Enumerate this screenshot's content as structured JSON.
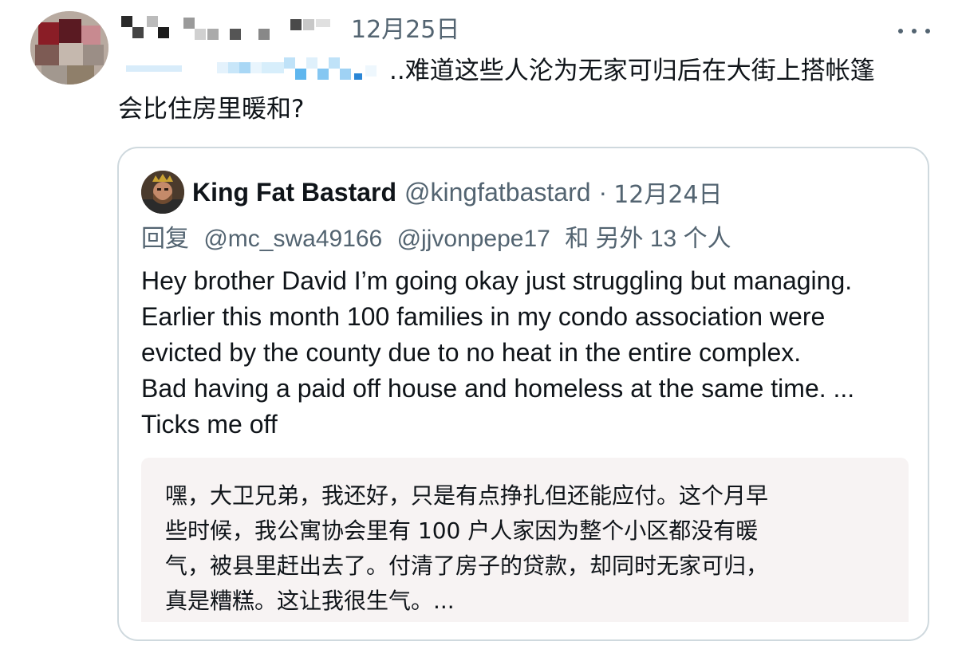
{
  "post": {
    "date": "12月25日",
    "text_line1": "..难道这些人沦为无家可归后在大街上搭帐篷",
    "text_line2": "会比住房里暖和?"
  },
  "quoted": {
    "display_name": "King Fat Bastard",
    "handle": "@kingfatbastard",
    "separator": "·",
    "date": "12月24日",
    "reply_prefix": "回复",
    "reply_handle_1": "@mc_swa49166",
    "reply_handle_2": "@jjvonpepe17",
    "reply_suffix": "和 另外 13 个人",
    "body_lines": [
      "Hey brother David I’m going okay just struggling but managing.",
      "Earlier this month 100 families in my condo association were",
      "evicted by the county due to no heat in the entire complex.",
      "Bad having a paid off house and homeless at the same time. ...",
      "Ticks me off"
    ],
    "translation_lines": [
      "嘿，大卫兄弟，我还好，只是有点挣扎但还能应付。这个月早",
      "些时候，我公寓协会里有 100 户人家因为整个小区都没有暖",
      "气，被县里赶出去了。付清了房子的贷款，却同时无家可归，",
      "真是糟糕。这让我很生气。..."
    ]
  },
  "icons": {
    "more": "more-horizontal-icon",
    "author_avatar": "blurred-avatar",
    "quoted_avatar": "king-avatar"
  },
  "colors": {
    "text": "#0f1419",
    "secondary": "#536471",
    "border": "#cfd9de",
    "translation_bg": "#f7f3f3"
  }
}
